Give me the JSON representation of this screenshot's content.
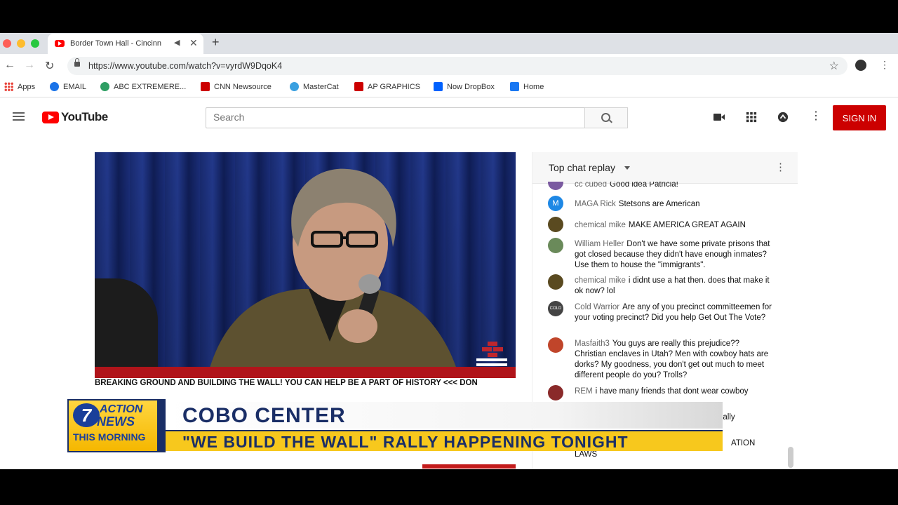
{
  "browser": {
    "tab_title": "Border Town Hall - Cincinn",
    "url": "https://www.youtube.com/watch?v=vyrdW9DqoK4",
    "new_tab_symbol": "+",
    "close_symbol": "✕"
  },
  "bookmarks": [
    {
      "label": "Apps",
      "icon": "apps-grid-icon",
      "color": "#e8453c"
    },
    {
      "label": "EMAIL",
      "icon": "email-icon",
      "color": "#1a73e8"
    },
    {
      "label": "ABC EXTREMERE...",
      "icon": "abc-icon",
      "color": "#2e9e63"
    },
    {
      "label": "CNN Newsource",
      "icon": "cnn-icon",
      "color": "#cc0000"
    },
    {
      "label": "MasterCat",
      "icon": "mastercat-icon",
      "color": "#3aa0e0"
    },
    {
      "label": "AP GRAPHICS",
      "icon": "ap-icon",
      "color": "#cc0000"
    },
    {
      "label": "Now DropBox",
      "icon": "dropbox-icon",
      "color": "#0061fe"
    },
    {
      "label": "Home",
      "icon": "facebook-icon",
      "color": "#1877f2"
    }
  ],
  "youtube": {
    "logo_text": "YouTube",
    "search_placeholder": "Search",
    "sign_in": "SIGN IN"
  },
  "video": {
    "ticker": "BREAKING GROUND AND BUILDING THE WALL! YOU CAN HELP BE A PART OF HISTORY <<< DON"
  },
  "chat": {
    "title": "Top chat replay",
    "messages": [
      {
        "author": "cc cubed",
        "text": "Good idea Patricia!",
        "avatar": "",
        "avatar_color": "#7a5aa0"
      },
      {
        "author": "MAGA Rick",
        "text": "Stetsons are American",
        "avatar": "M",
        "avatar_color": "#1e88e5"
      },
      {
        "author": "chemical mike",
        "text": "MAKE AMERICA GREAT AGAIN",
        "avatar": "",
        "avatar_color": "#5a4a20"
      },
      {
        "author": "William Heller",
        "text": "Don't we have some private prisons that got closed because they didn't have enough inmates? Use them to house the \"immigrants\".",
        "avatar": "",
        "avatar_color": "#6a8a5a"
      },
      {
        "author": "chemical mike",
        "text": "i didnt use a hat then. does that make it ok now? lol",
        "avatar": "",
        "avatar_color": "#5a4a20"
      },
      {
        "author": "Cold Warrior",
        "text": "Are any of you precinct committeemen for your voting precinct? Did you help Get Out The Vote?",
        "avatar": "COLD",
        "avatar_color": "#444444"
      },
      {
        "author": "Masfaith3",
        "text": "You guys are really this prejudice?? Christian enclaves in Utah? Men with cowboy hats are dorks? My goodness, you don't get out much to meet different people do you? Trolls?",
        "avatar": "",
        "avatar_color": "#c0452a"
      },
      {
        "author": "REM",
        "text": "i have many friends that dont wear cowboy",
        "avatar": "",
        "avatar_color": "#8a2a2a"
      }
    ],
    "partial_1": "ually",
    "partial_2": "ATION",
    "partial_3": "LAWS"
  },
  "lower_third": {
    "channel_number": "7",
    "action": "ACTION",
    "news": "NEWS",
    "show": "THIS MORNING",
    "headline": "COBO CENTER",
    "subheadline": "\"WE BUILD THE WALL\" RALLY HAPPENING TONIGHT"
  }
}
